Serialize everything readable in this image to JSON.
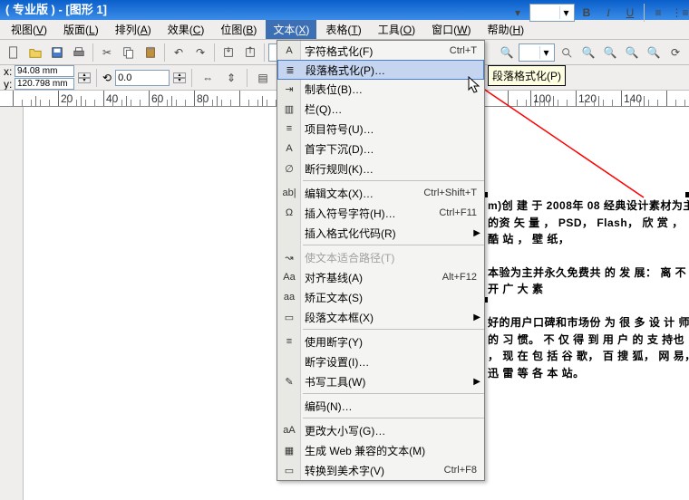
{
  "title": "(  专业版  )   -   [图形 1]",
  "menubar": [
    {
      "label": "视图",
      "key": "V"
    },
    {
      "label": "版面",
      "key": "L"
    },
    {
      "label": "排列",
      "key": "A"
    },
    {
      "label": "效果",
      "key": "C"
    },
    {
      "label": "位图",
      "key": "B"
    },
    {
      "label": "文本",
      "key": "X",
      "active": true
    },
    {
      "label": "表格",
      "key": "T"
    },
    {
      "label": "工具",
      "key": "O"
    },
    {
      "label": "窗口",
      "key": "W"
    },
    {
      "label": "帮助",
      "key": "H"
    }
  ],
  "statusbar": {
    "x_val": "94.08 mm",
    "y_val": "120.798 mm",
    "angle": "0.0"
  },
  "zoom_combo": "",
  "tooltip": "段落格式化(P)",
  "dropdown": [
    {
      "type": "item",
      "label": "字符格式化(F)",
      "shortcut": "Ctrl+T",
      "icon": "A"
    },
    {
      "type": "item",
      "label": "段落格式化(P)…",
      "hl": true,
      "icon": "≣"
    },
    {
      "type": "item",
      "label": "制表位(B)…",
      "icon": "⇥"
    },
    {
      "type": "item",
      "label": "栏(Q)…",
      "icon": "▥"
    },
    {
      "type": "item",
      "label": "项目符号(U)…",
      "icon": "≡"
    },
    {
      "type": "item",
      "label": "首字下沉(D)…",
      "icon": "A"
    },
    {
      "type": "item",
      "label": "断行规则(K)…",
      "icon": "∅"
    },
    {
      "type": "sep"
    },
    {
      "type": "item",
      "label": "编辑文本(X)…",
      "shortcut": "Ctrl+Shift+T",
      "icon": "ab|"
    },
    {
      "type": "item",
      "label": "插入符号字符(H)…",
      "shortcut": "Ctrl+F11",
      "icon": "Ω"
    },
    {
      "type": "item",
      "label": "插入格式化代码(R)",
      "arrow": true
    },
    {
      "type": "sep"
    },
    {
      "type": "item",
      "label": "使文本适合路径(T)",
      "disabled": true,
      "icon": "↝"
    },
    {
      "type": "item",
      "label": "对齐基线(A)",
      "shortcut": "Alt+F12",
      "icon": "Aa"
    },
    {
      "type": "item",
      "label": "矫正文本(S)",
      "icon": "aa"
    },
    {
      "type": "item",
      "label": "段落文本框(X)",
      "arrow": true,
      "icon": "▭"
    },
    {
      "type": "sep"
    },
    {
      "type": "item",
      "label": "使用断字(Y)",
      "icon": "≡"
    },
    {
      "type": "item",
      "label": "断字设置(I)…"
    },
    {
      "type": "item",
      "label": "书写工具(W)",
      "arrow": true,
      "icon": "✎"
    },
    {
      "type": "sep"
    },
    {
      "type": "item",
      "label": "编码(N)…"
    },
    {
      "type": "sep"
    },
    {
      "type": "item",
      "label": "更改大小写(G)…",
      "icon": "aA"
    },
    {
      "type": "item",
      "label": "生成 Web 兼容的文本(M)",
      "icon": "▦"
    },
    {
      "type": "item",
      "label": "转换到美术字(V)",
      "shortcut": "Ctrl+F8",
      "icon": "▭"
    }
  ],
  "ruler_ticks": [
    {
      "pos": 14,
      "label": ""
    },
    {
      "pos": 64,
      "label": "20"
    },
    {
      "pos": 114,
      "label": "40"
    },
    {
      "pos": 164,
      "label": "60"
    },
    {
      "pos": 214,
      "label": "80"
    },
    {
      "pos": 264,
      "label": ""
    },
    {
      "pos": 314,
      "label": ""
    },
    {
      "pos": 560,
      "label": ""
    },
    {
      "pos": 585,
      "label": "100"
    },
    {
      "pos": 635,
      "label": "120"
    },
    {
      "pos": 685,
      "label": "140"
    },
    {
      "pos": 735,
      "label": ""
    }
  ],
  "bodytext": {
    "p1": "m)创 建 于 2008年 08 经典设计素材为主的资 矢 量 ， PSD， Flash， 欣 赏 ， 酷 站 ， 壁 纸，",
    "p2": "本验为主并永久免费共 的 发 展： 离 不 开 广 大 素",
    "p3": "好的用户口碑和市场份 为 很 多 设 计 师 的 习 惯。 不 仅 得 到 用 户 的 支 持也 ， 现 在 包 括 谷 歌， 百 搜 狐， 网 易， 迅 雷 等 各 本 站。"
  },
  "toolbar2_right": {
    "font_style_b": "B",
    "font_style_i": "I",
    "font_style_u": "U"
  }
}
